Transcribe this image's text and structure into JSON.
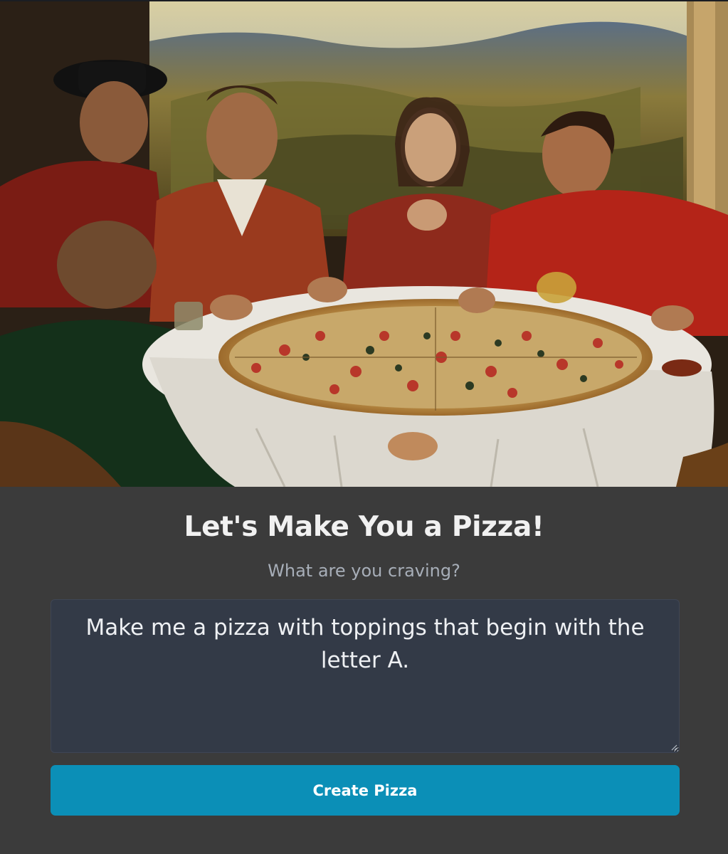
{
  "hero": {
    "image_description": "hero-painting"
  },
  "heading": {
    "title": "Let's Make You a Pizza!",
    "subtitle": "What are you craving?"
  },
  "prompt": {
    "value": "Make me a pizza with toppings that begin with the letter A.",
    "placeholder": ""
  },
  "actions": {
    "create_label": "Create Pizza"
  },
  "colors": {
    "background": "#3b3b3b",
    "textarea_bg": "#333a47",
    "button_bg": "#0b8fb7",
    "subtitle": "#a7aeb8"
  }
}
